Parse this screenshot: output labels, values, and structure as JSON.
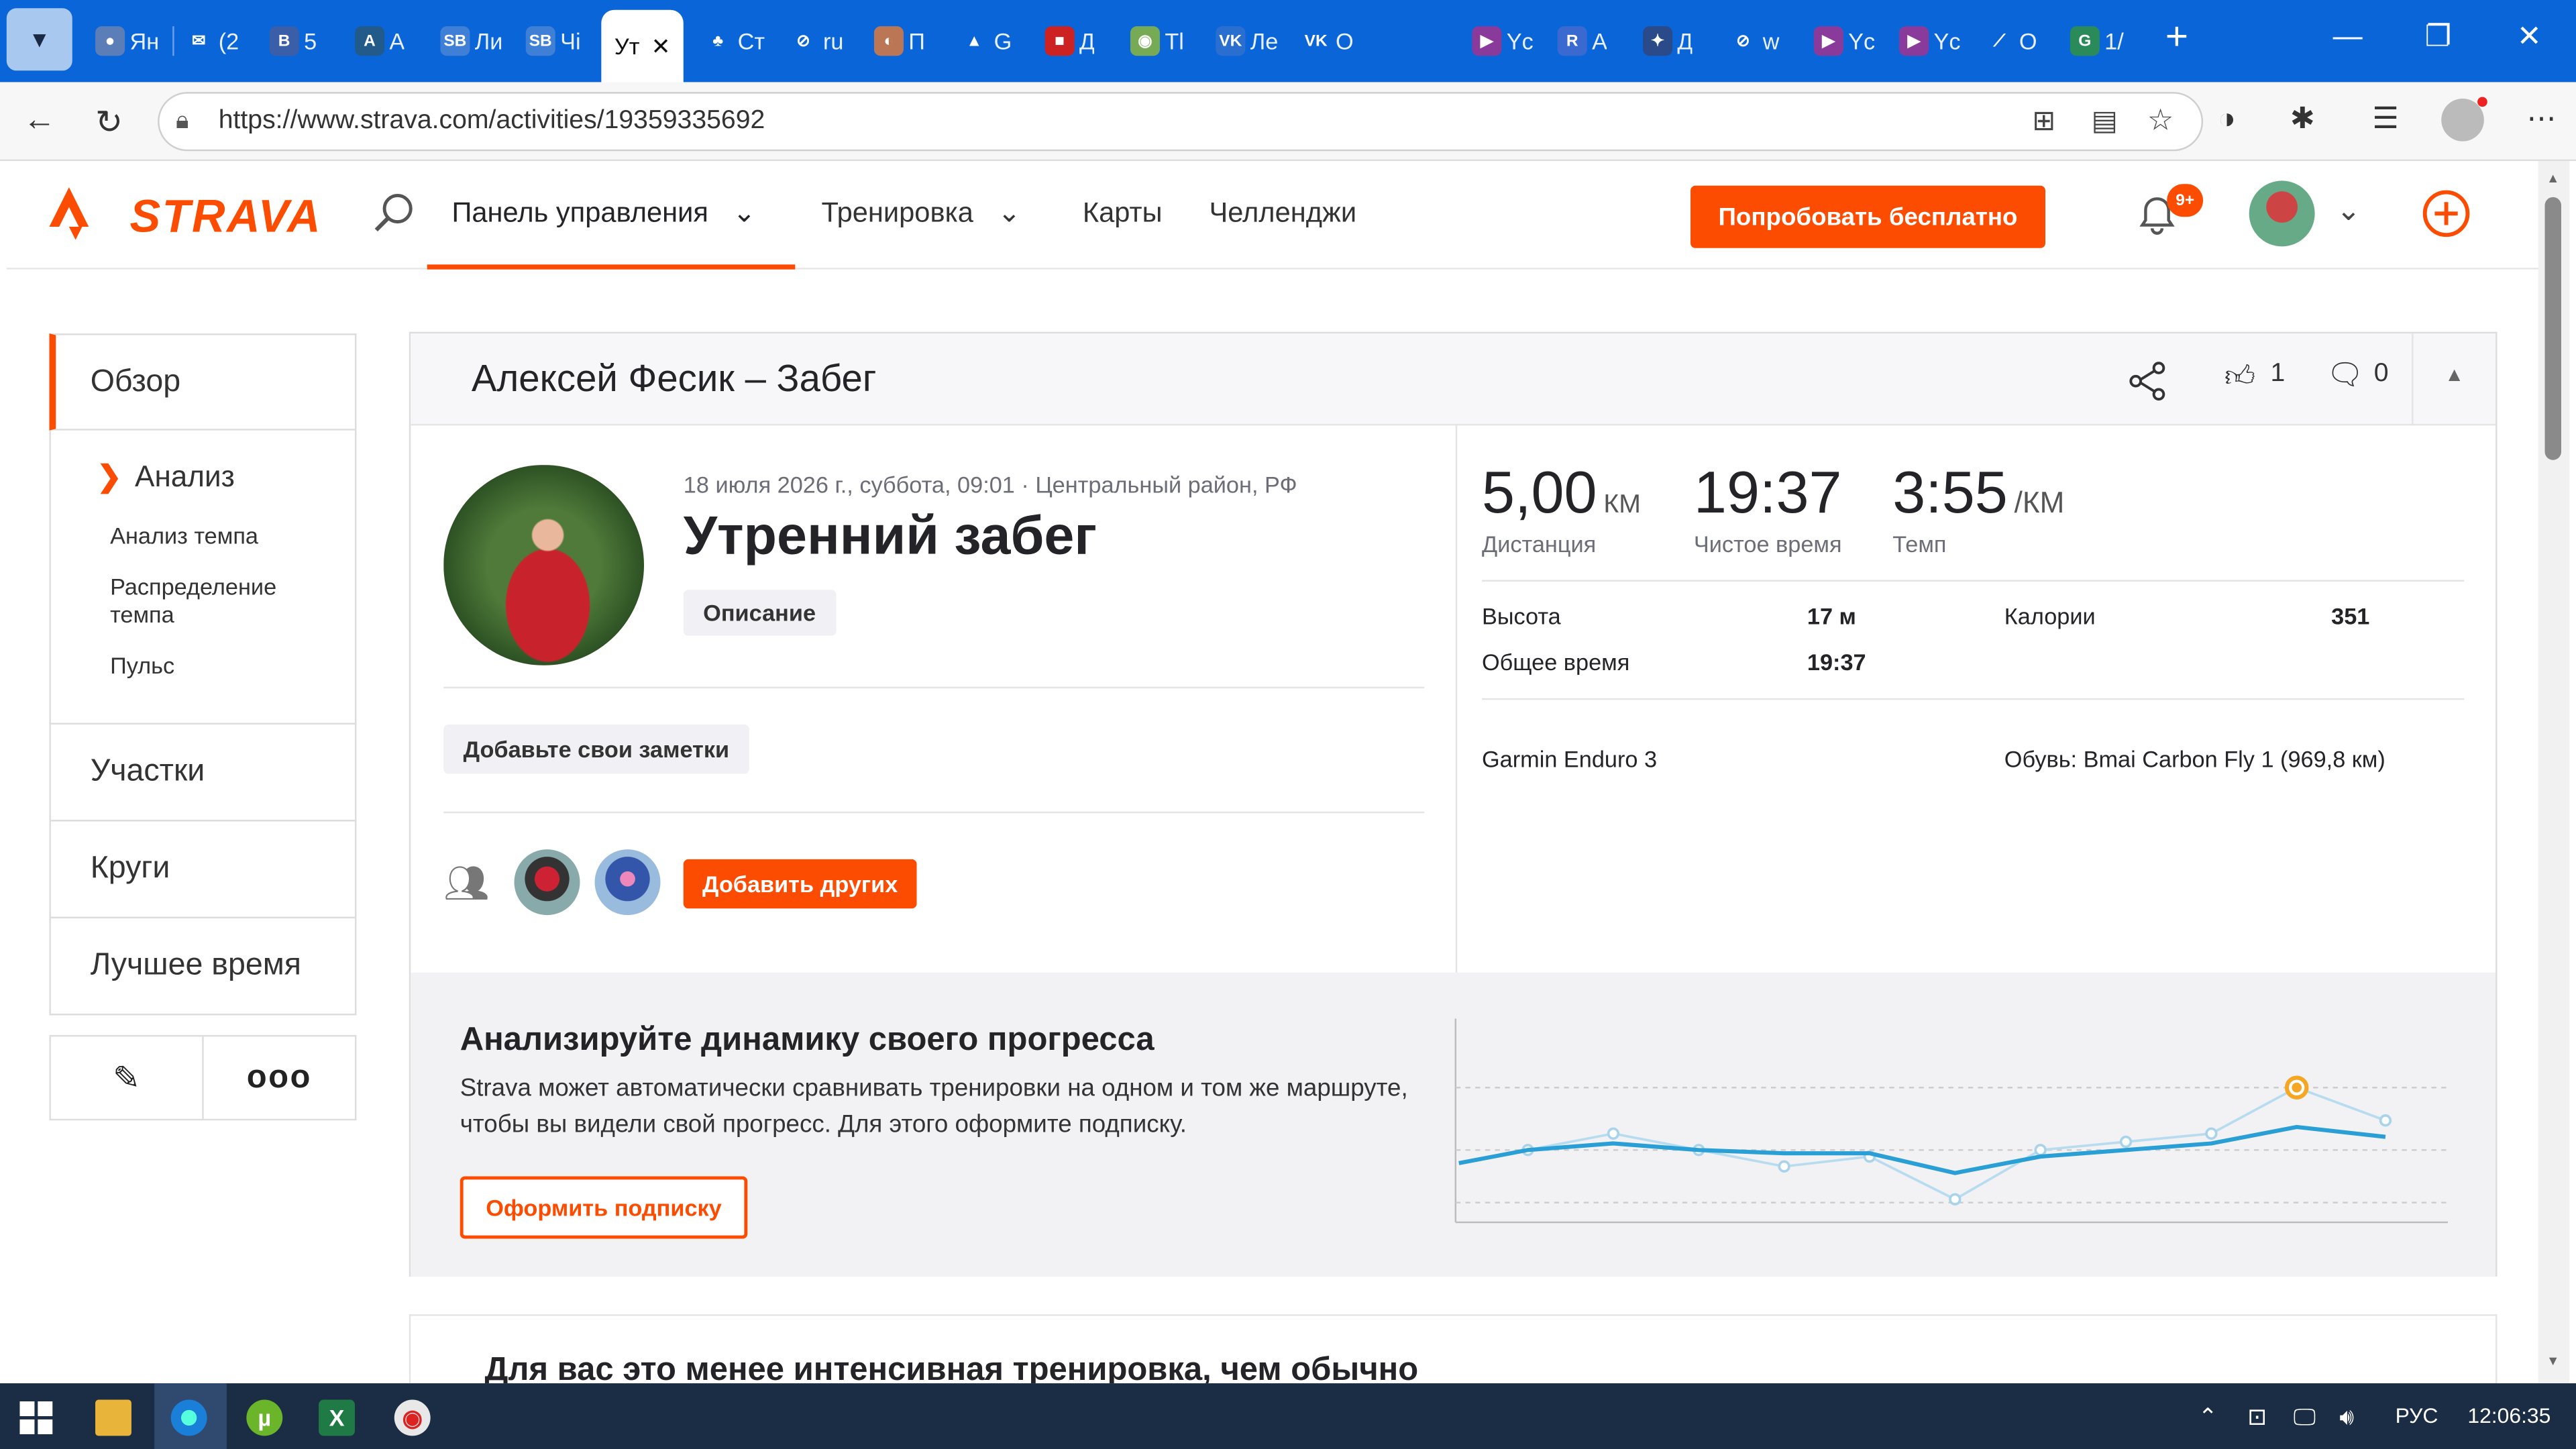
{
  "browser": {
    "active_tab_label": "Ут",
    "tabs": [
      "Ян",
      "(2",
      "5",
      "А",
      "Ли",
      "Чі",
      "Ст",
      "ru",
      "П",
      "G",
      "Д",
      "Tl",
      "Ле",
      "О",
      "Yc",
      "А",
      "Д",
      "w",
      "Yc",
      "Yc",
      "О",
      "1/"
    ],
    "url": "https://www.strava.com/activities/19359335692"
  },
  "nav": {
    "logo": "STRAVA",
    "dashboard": "Панель управления",
    "training": "Тренировка",
    "maps": "Карты",
    "challenges": "Челленджи",
    "try_free": "Попробовать бесплатно",
    "notifications_badge": "9+"
  },
  "sidebar": {
    "overview": "Обзор",
    "analysis": "Анализ",
    "pace_analysis": "Анализ темпа",
    "pace_distribution": "Распределение темпа",
    "heart_rate": "Пульс",
    "segments": "Участки",
    "laps": "Круги",
    "best_efforts": "Лучшее время"
  },
  "activity": {
    "header_title": "Алексей Фесик – Забег",
    "kudos_count": "1",
    "comments_count": "0",
    "datetime_location": "18 июля 2026 г., суббота, 09:01 · Центральный район, РФ",
    "title": "Утренний забег",
    "description_button": "Описание",
    "add_notes_button": "Добавьте свои заметки",
    "add_others_button": "Добавить других"
  },
  "stats": {
    "distance_value": "5,00",
    "distance_unit": "КМ",
    "distance_label": "Дистанция",
    "moving_time_value": "19:37",
    "moving_time_label": "Чистое время",
    "pace_value": "3:55",
    "pace_unit": "/КМ",
    "pace_label": "Темп",
    "elevation_label": "Высота",
    "elevation_value": "17 м",
    "calories_label": "Калории",
    "calories_value": "351",
    "elapsed_label": "Общее время",
    "elapsed_value": "19:37",
    "device": "Garmin Enduro 3",
    "shoes": "Обувь: Bmai Carbon Fly 1 (969,8 км)"
  },
  "upsell": {
    "title": "Анализируйте динамику своего прогресса",
    "text": "Strava может автоматически сравнивать тренировки на одном и том же маршруте, чтобы вы видели свой прогресс. Для этого оформите подписку.",
    "button": "Оформить подписку"
  },
  "next_card_title": "Для вас это менее интенсивная тренировка, чем обычно",
  "taskbar": {
    "lang": "РУС",
    "time": "12:06:35"
  },
  "colors": {
    "brand": "#fc4c02",
    "tabbar": "#0a66d8",
    "chart_line": "#2a9fd6"
  }
}
